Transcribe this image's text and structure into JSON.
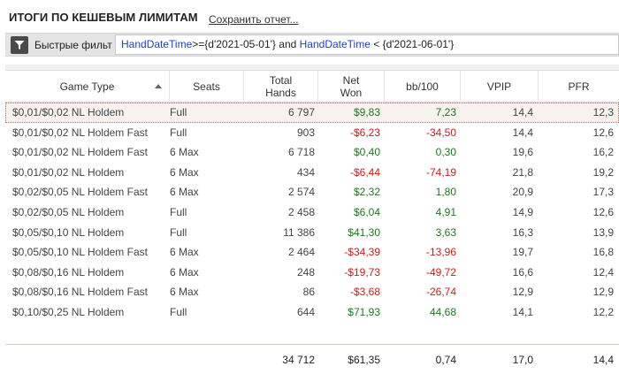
{
  "header": {
    "title": "ИТОГИ ПО КЕШЕВЫМ ЛИМИТАМ",
    "save_link": "Сохранить отчет..."
  },
  "filter": {
    "icon": "filter-icon",
    "label": "Быстрые фильт",
    "query": {
      "field1": "HandDateTime",
      "op1": ">={d'2021-05-01'} and ",
      "field2": "HandDateTime",
      "op2": " < {d'2021-06-01'}"
    }
  },
  "table": {
    "columns": [
      {
        "key": "game_type",
        "label": "Game Type",
        "sorted": true
      },
      {
        "key": "seats",
        "label": "Seats"
      },
      {
        "key": "total_hands",
        "label": "Total Hands"
      },
      {
        "key": "net_won",
        "label": "Net Won"
      },
      {
        "key": "bb100",
        "label": "bb/100"
      },
      {
        "key": "vpip",
        "label": "VPIP"
      },
      {
        "key": "pfr",
        "label": "PFR"
      }
    ],
    "rows": [
      {
        "game_type": "$0,01/$0,02 NL Holdem",
        "seats": "Full",
        "total_hands": "6 797",
        "net_won": "$9,83",
        "net_sign": "pos",
        "bb100": "7,23",
        "bb_sign": "pos",
        "vpip": "14,4",
        "pfr": "12,3"
      },
      {
        "game_type": "$0,01/$0,02 NL Holdem Fast",
        "seats": "Full",
        "total_hands": "903",
        "net_won": "-$6,23",
        "net_sign": "neg",
        "bb100": "-34,50",
        "bb_sign": "neg",
        "vpip": "14,4",
        "pfr": "12,6"
      },
      {
        "game_type": "$0,01/$0,02 NL Holdem Fast",
        "seats": "6 Max",
        "total_hands": "6 718",
        "net_won": "$0,40",
        "net_sign": "pos",
        "bb100": "0,30",
        "bb_sign": "pos",
        "vpip": "19,6",
        "pfr": "16,2"
      },
      {
        "game_type": "$0,01/$0,02 NL Holdem",
        "seats": "6 Max",
        "total_hands": "434",
        "net_won": "-$6,44",
        "net_sign": "neg",
        "bb100": "-74,19",
        "bb_sign": "neg",
        "vpip": "21,8",
        "pfr": "19,2"
      },
      {
        "game_type": "$0,02/$0,05 NL Holdem Fast",
        "seats": "6 Max",
        "total_hands": "2 574",
        "net_won": "$2,32",
        "net_sign": "pos",
        "bb100": "1,80",
        "bb_sign": "pos",
        "vpip": "20,9",
        "pfr": "17,3"
      },
      {
        "game_type": "$0,02/$0,05 NL Holdem",
        "seats": "Full",
        "total_hands": "2 458",
        "net_won": "$6,04",
        "net_sign": "pos",
        "bb100": "4,91",
        "bb_sign": "pos",
        "vpip": "14,9",
        "pfr": "12,6"
      },
      {
        "game_type": "$0,05/$0,10 NL Holdem",
        "seats": "Full",
        "total_hands": "11 386",
        "net_won": "$41,30",
        "net_sign": "pos",
        "bb100": "3,63",
        "bb_sign": "pos",
        "vpip": "16,3",
        "pfr": "13,9"
      },
      {
        "game_type": "$0,05/$0,10 NL Holdem Fast",
        "seats": "6 Max",
        "total_hands": "2 464",
        "net_won": "-$34,39",
        "net_sign": "neg",
        "bb100": "-13,96",
        "bb_sign": "neg",
        "vpip": "19,7",
        "pfr": "16,8"
      },
      {
        "game_type": "$0,08/$0,16 NL Holdem",
        "seats": "6 Max",
        "total_hands": "248",
        "net_won": "-$19,73",
        "net_sign": "neg",
        "bb100": "-49,72",
        "bb_sign": "neg",
        "vpip": "16,6",
        "pfr": "12,4"
      },
      {
        "game_type": "$0,08/$0,16 NL Holdem Fast",
        "seats": "6 Max",
        "total_hands": "86",
        "net_won": "-$3,68",
        "net_sign": "neg",
        "bb100": "-26,74",
        "bb_sign": "neg",
        "vpip": "12,9",
        "pfr": "12,9"
      },
      {
        "game_type": "$0,10/$0,25 NL Holdem",
        "seats": "Full",
        "total_hands": "644",
        "net_won": "$71,93",
        "net_sign": "pos",
        "bb100": "44,68",
        "bb_sign": "pos",
        "vpip": "14,1",
        "pfr": "12,2"
      }
    ],
    "totals": {
      "total_hands": "34 712",
      "net_won": "$61,35",
      "bb100": "0,74",
      "vpip": "17,0",
      "pfr": "14,4"
    },
    "colors": {
      "positive": "#1a7a1a",
      "negative": "#d41a1a",
      "keyword": "#1f3fd6"
    }
  }
}
